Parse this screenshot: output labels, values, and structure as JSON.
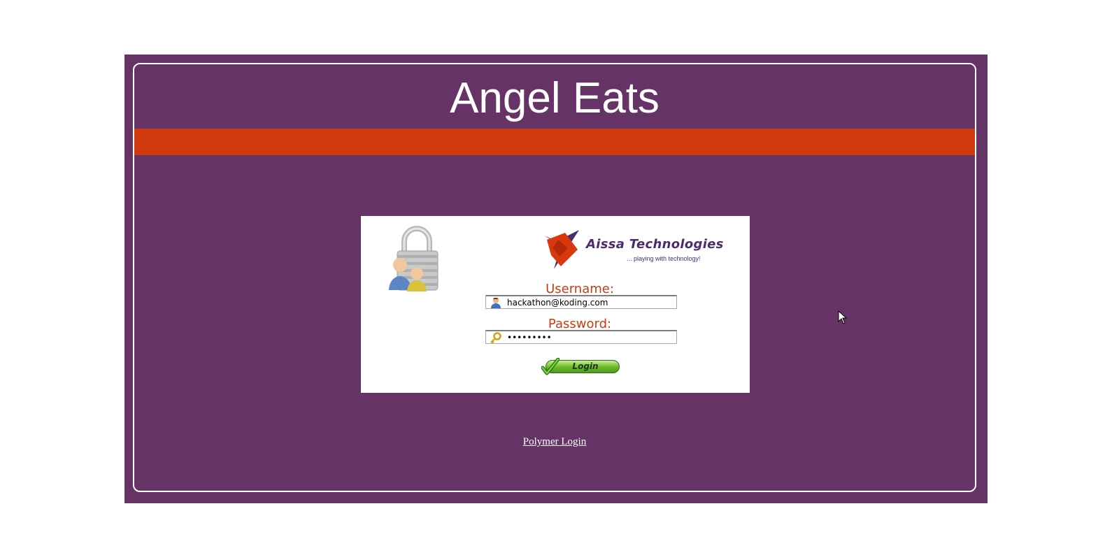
{
  "header": {
    "title": "Angel Eats"
  },
  "login_card": {
    "brand_name": "Aissa Technologies",
    "brand_tagline": "... playing with technology!",
    "username_label": "Username:",
    "username_value": "hackathon@koding.com",
    "password_label": "Password:",
    "password_value": "*********",
    "login_label": "Login"
  },
  "footer": {
    "polymer_link": "Polymer Login"
  },
  "colors": {
    "frame": "#653366",
    "accent_bar": "#cf3a0f",
    "label": "#cf3a0f",
    "brand": "#4b2d6e"
  },
  "icons": [
    "lock-users-icon",
    "aissa-logo-icon",
    "user-icon",
    "key-icon",
    "checkmark-icon",
    "mouse-cursor-icon"
  ]
}
